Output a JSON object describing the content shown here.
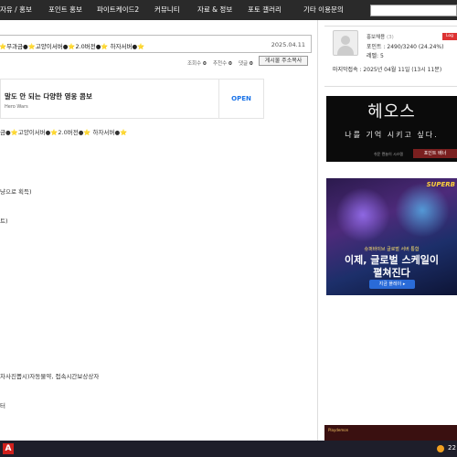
{
  "nav": {
    "items": [
      "자유 / 홍보",
      "포인트 홍보",
      "파이트케이드2",
      "커뮤니티",
      "자료 & 정보",
      "포토 갤러리",
      "기타 이용문의"
    ]
  },
  "post": {
    "title": "⭐무과금●⭐고양이서버●⭐2.0버전●⭐ 하자서버●⭐",
    "date": "2025.04.11",
    "views_label": "조회수",
    "views": "0",
    "likes_label": "추천수",
    "likes": "0",
    "comments_label": "댓글",
    "comments": "0",
    "copy_button": "게시물 주소복사"
  },
  "ad": {
    "title": "말도 안 되는 다양한 영웅 콤보",
    "advertiser": "Hero Wars",
    "cta": "OPEN"
  },
  "body": {
    "lines": [
      "금●⭐고양이서버●⭐2.0버전●⭐ 하자서버●⭐",
      "냥으로 획득)",
      "트)",
      "차사진뽑시)자동물약, 접속시간보상상자",
      "터"
    ]
  },
  "profile": {
    "name": "홍보채용",
    "level_tag": "(3)",
    "points": "포인트 : 2490/3240 (24.24%)",
    "level": "레벨: 5",
    "last_login": "마지막접속 : 2025년 04월 11일 (13시 11분)",
    "logout": "Log Out"
  },
  "banner1": {
    "title": "헤오스",
    "subtitle": "나를 기억 시키고 싶다.",
    "footer": "쉬운 캔놀이 시스템",
    "button": "포인트 배너"
  },
  "banner2": {
    "logo": "SUPERB",
    "small": "슈퍼바이브 글로벌 서버 통합",
    "line1": "이제, 글로벌 스케일이",
    "line2": "펼쳐진다",
    "button": "지금 플레이 ▸"
  },
  "banner3": {
    "text": "Playdemon"
  },
  "taskbar": {
    "app_icon": "A",
    "tray_text": "22"
  },
  "colors": {
    "nav_bg": "#2a2a2a",
    "logout_red": "#d33333",
    "ad_cta_blue": "#1a73e8",
    "taskbar_bg": "#1e1e2a"
  }
}
